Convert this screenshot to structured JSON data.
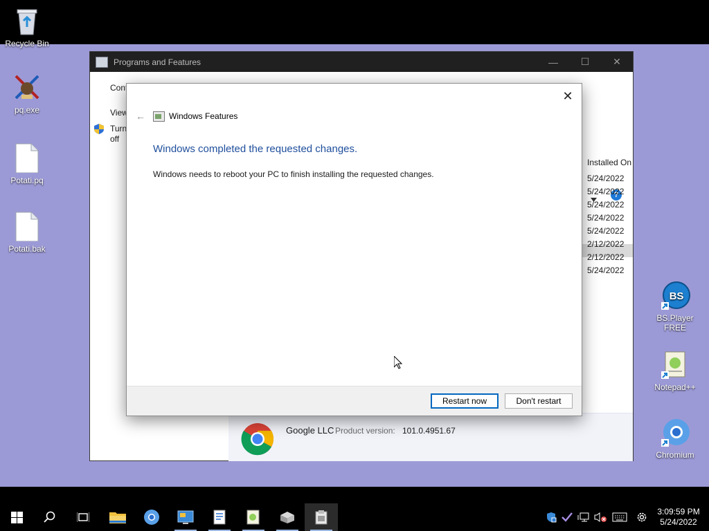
{
  "desktop": {
    "icons_left": [
      {
        "label": "Recycle Bin"
      },
      {
        "label": "pq.exe"
      },
      {
        "label": "Potati.pq"
      },
      {
        "label": "Potati.bak"
      }
    ],
    "icons_right": [
      {
        "label": "BS.Player FREE"
      },
      {
        "label": "Notepad++"
      },
      {
        "label": "Chromium"
      }
    ]
  },
  "programs_window": {
    "title": "Programs and Features",
    "controls": {
      "minimize": "—",
      "maximize": "☐",
      "close": "✕"
    },
    "sidebar": {
      "item1": "Cont",
      "item2": "View",
      "item3_line1": "Turn",
      "item3_line2": "off"
    },
    "column_header": "Installed On",
    "dates": [
      "5/24/2022",
      "5/24/2022",
      "5/24/2022",
      "5/24/2022",
      "5/24/2022",
      "2/12/2022",
      "2/12/2022",
      "5/24/2022"
    ],
    "details": {
      "publisher": "Google LLC",
      "version_label": "Product version:",
      "version_value": "101.0.4951.67"
    }
  },
  "dialog": {
    "title": "Windows Features",
    "back_glyph": "←",
    "close_glyph": "✕",
    "heading": "Windows completed the requested changes.",
    "message": "Windows needs to reboot your PC to finish installing the requested changes.",
    "buttons": {
      "restart": "Restart now",
      "dont_restart": "Don't restart"
    }
  },
  "taskbar": {
    "time": "3:09:59 PM",
    "date": "5/24/2022"
  },
  "colors": {
    "desktop": "#9c9ad6",
    "heading_blue": "#1e4e9c",
    "accent": "#0067c0"
  }
}
